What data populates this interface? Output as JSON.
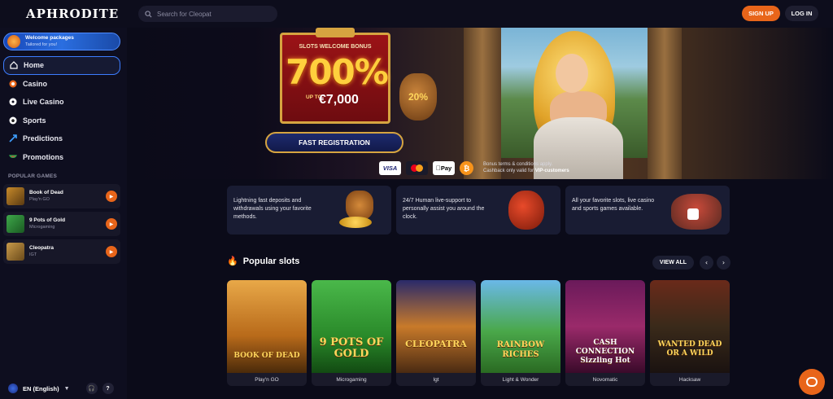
{
  "brand": {
    "logo": "APHRODITE",
    "accent": "#e8651a",
    "active_border": "#3c7dff"
  },
  "header": {
    "search_placeholder": "Search for Cleopat",
    "signup_label": "SIGN UP",
    "login_label": "LOG IN"
  },
  "sidebar": {
    "promo": {
      "title": "Welcome packages",
      "subtitle": "Tailored for you!"
    },
    "nav": [
      {
        "label": "Home",
        "icon": "home-icon",
        "active": true
      },
      {
        "label": "Casino",
        "icon": "casino-chip-icon"
      },
      {
        "label": "Live Casino",
        "icon": "live-casino-icon"
      },
      {
        "label": "Sports",
        "icon": "soccer-ball-icon"
      },
      {
        "label": "Predictions",
        "icon": "trend-arrow-icon"
      },
      {
        "label": "Promotions",
        "icon": "watermelon-icon"
      }
    ],
    "popular_games_label": "POPULAR GAMES",
    "games": [
      {
        "title": "Book of Dead",
        "provider": "Play'n GO"
      },
      {
        "title": "9 Pots of Gold",
        "provider": "Microgaming"
      },
      {
        "title": "Cleopatra",
        "provider": "IGT"
      }
    ],
    "language": "EN (English)"
  },
  "hero": {
    "bonus_caption": "SLOTS WELCOME BONUS",
    "bonus_percent": "700%",
    "bonus_upto": "UP TO",
    "bonus_amount": "€7,000",
    "vase_badge": "20%",
    "register_label": "FAST REGISTRATION",
    "payments": [
      "VISA",
      "Mastercard",
      "Pay",
      "₿"
    ],
    "terms_line1": "Bonus terms & conditions apply.",
    "terms_line2": "Cashback only valid for",
    "terms_vip": "VIP-customers"
  },
  "features": [
    {
      "line1": "Lightning fast deposits and",
      "line2": "withdrawals using your favorite",
      "line3": "methods."
    },
    {
      "line1": "24/7 Human live-support to",
      "line2": "personally assist you around the",
      "line3": "clock."
    },
    {
      "line1": "All your favorite slots, live casino",
      "line2": "and sports games available.",
      "line3": ""
    }
  ],
  "popular_slots": {
    "title": "Popular slots",
    "view_all": "VIEW ALL",
    "prev": "‹",
    "next": "›",
    "games": [
      {
        "name": "BOOK OF DEAD",
        "provider": "Play'n GO"
      },
      {
        "name": "9 POTS OF GOLD",
        "provider": "Microgaming"
      },
      {
        "name": "CLEOPATRA",
        "provider": "Igt"
      },
      {
        "name": "RAINBOW RICHES",
        "provider": "Light & Wonder"
      },
      {
        "name": "CASH CONNECTION Sizzling Hot",
        "provider": "Novomatic"
      },
      {
        "name": "WANTED DEAD OR A WILD",
        "provider": "Hacksaw"
      }
    ]
  }
}
